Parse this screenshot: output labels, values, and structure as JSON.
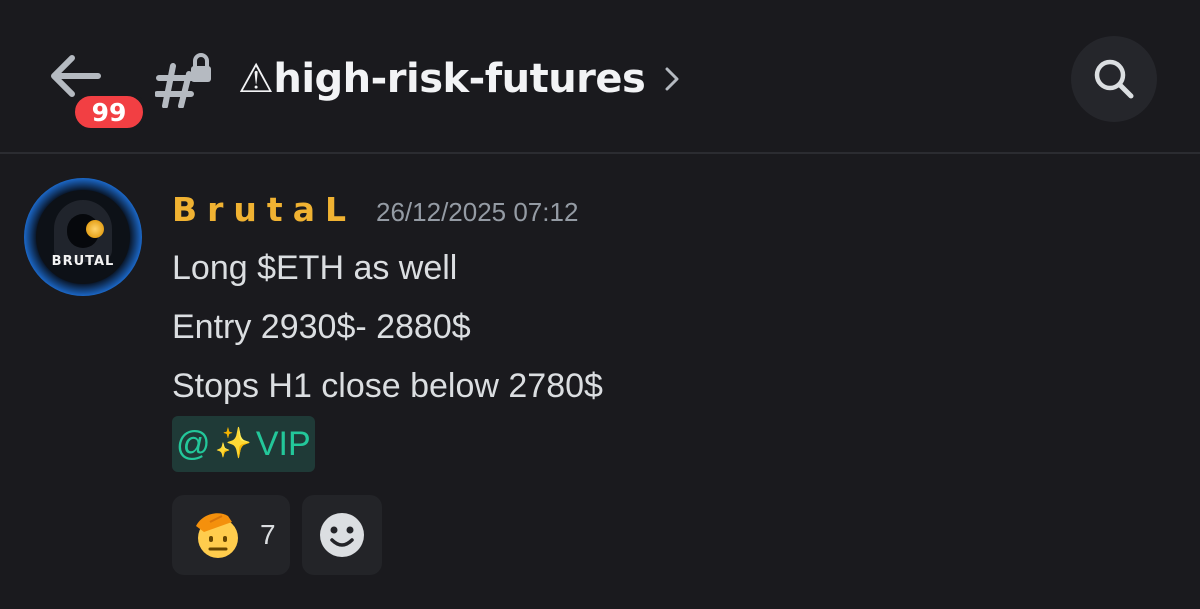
{
  "header": {
    "back_icon": "arrow-left-icon",
    "unread_badge": "99",
    "channel_icon": "locked-hash-icon",
    "channel_name": "⚠high-risk-futures",
    "chevron_icon": "chevron-right-icon",
    "search_icon": "search-icon"
  },
  "message": {
    "author": "BrutaL",
    "author_color": "#f0b232",
    "timestamp": "26/12/2025 07:12",
    "avatar_text": "BRUTAL",
    "lines": [
      "Long $ETH as well",
      "Entry 2930$- 2880$",
      "Stops H1 close below 2780$"
    ],
    "mention": {
      "at": "@",
      "emoji": "✨",
      "role": "VIP",
      "color": "#23c79a"
    },
    "reactions": [
      {
        "emoji": "saluting-face",
        "count": "7"
      },
      {
        "emoji": "add-reaction-smile-icon"
      }
    ]
  },
  "colors": {
    "background": "#1a1a1e",
    "badge": "#f23f43",
    "text": "#dbdee1",
    "muted": "#949ba4"
  }
}
